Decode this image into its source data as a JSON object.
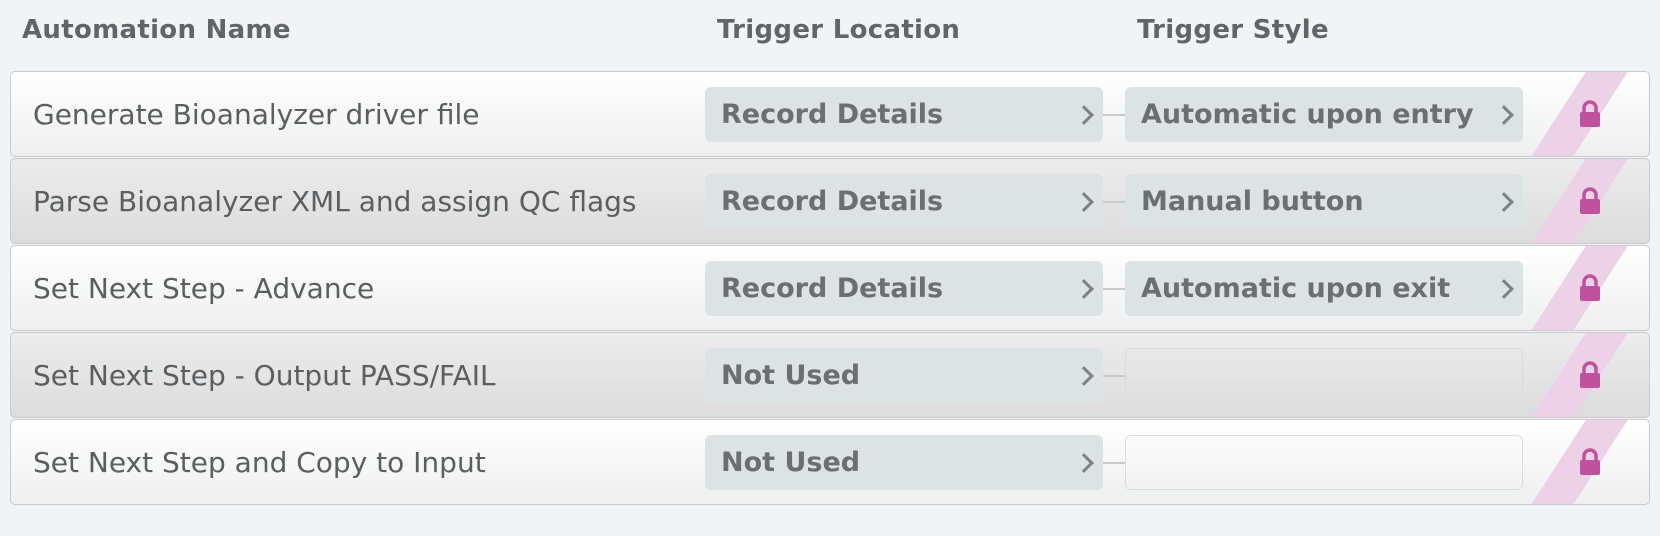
{
  "columns": {
    "name": "Automation Name",
    "trigger_location": "Trigger Location",
    "trigger_style": "Trigger Style"
  },
  "rows": [
    {
      "name": "Generate Bioanalyzer driver file",
      "trigger_location": "Record Details",
      "trigger_style": "Automatic upon entry",
      "locked": true
    },
    {
      "name": "Parse Bioanalyzer XML and assign QC flags",
      "trigger_location": "Record Details",
      "trigger_style": "Manual button",
      "locked": true
    },
    {
      "name": "Set Next Step - Advance",
      "trigger_location": "Record Details",
      "trigger_style": "Automatic upon exit",
      "locked": true
    },
    {
      "name": "Set Next Step - Output PASS/FAIL",
      "trigger_location": "Not Used",
      "trigger_style": "",
      "locked": true
    },
    {
      "name": "Set Next Step and Copy to Input",
      "trigger_location": "Not Used",
      "trigger_style": "",
      "locked": true
    }
  ],
  "icons": {
    "lock": "lock-icon",
    "chevron": "chevron-right-icon"
  },
  "colors": {
    "lock": "#c0529d",
    "lock_stripe": "#ecd2e6",
    "pill_bg": "#dde2e5"
  }
}
